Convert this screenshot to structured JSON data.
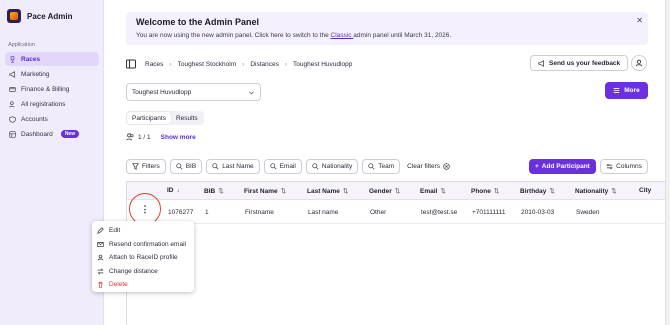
{
  "app": {
    "name": "Pace Admin"
  },
  "sidebar": {
    "section_label": "Application",
    "items": [
      {
        "label": "Races",
        "icon": "trophy-icon",
        "active": true
      },
      {
        "label": "Marketing",
        "icon": "megaphone-icon"
      },
      {
        "label": "Finance & Billing",
        "icon": "card-icon"
      },
      {
        "label": "All registrations",
        "icon": "users-icon"
      },
      {
        "label": "Accounts",
        "icon": "shield-icon"
      },
      {
        "label": "Dashboard",
        "icon": "dashboard-icon",
        "badge": "New"
      }
    ]
  },
  "banner": {
    "title": "Welcome to the Admin Panel",
    "text_before": "You are now using the new admin panel. Click here to switch to the ",
    "link": "Classic ",
    "text_after": "admin panel until March 31, 2026."
  },
  "breadcrumb": [
    "Races",
    "Toughest Stockholm",
    "Distances",
    "Toughest Huvudlopp"
  ],
  "feedback_label": "Send us your feedback",
  "distance_select": {
    "value": "Toughest Huvudlopp"
  },
  "more_label": "More",
  "tabs": [
    "Participants",
    "Results"
  ],
  "count": {
    "text": "1 / 1",
    "show_more": "Show more"
  },
  "filters": {
    "filters_label": "Filters",
    "chips": [
      "BIB",
      "Last Name",
      "Email",
      "Nationality",
      "Team"
    ],
    "clear": "Clear filters"
  },
  "add_participant_label": "Add Participant",
  "columns_label": "Columns",
  "table": {
    "headers": [
      "ID",
      "BIB",
      "First Name",
      "Last Name",
      "Gender",
      "Email",
      "Phone",
      "Birthday",
      "Nationality",
      "City"
    ],
    "rows": [
      [
        "1076277",
        "1",
        "Firstname",
        "Last name",
        "Other",
        "test@test.se",
        "+701111111",
        "2010-03-03",
        "Sweden",
        ""
      ]
    ]
  },
  "row_menu": {
    "items": [
      {
        "label": "Edit",
        "icon": "pencil-icon"
      },
      {
        "label": "Resend confirmation email",
        "icon": "mail-icon"
      },
      {
        "label": "Attach to RaceID profile",
        "icon": "user-icon"
      },
      {
        "label": "Change distance",
        "icon": "swap-icon"
      },
      {
        "label": "Delete",
        "icon": "trash-icon",
        "danger": true
      }
    ]
  },
  "colors": {
    "accent": "#6a2fdf",
    "danger": "#d8343a",
    "sidebar_bg": "#f1ecfb",
    "highlight_circle": "#e0402c"
  }
}
